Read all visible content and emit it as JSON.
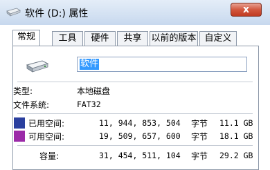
{
  "window": {
    "title": "软件 (D:) 属性",
    "close_symbol": "x"
  },
  "tabs": [
    {
      "label": "常规",
      "active": true
    },
    {
      "label": "工具"
    },
    {
      "label": "硬件"
    },
    {
      "label": "共享"
    },
    {
      "label": "以前的版本"
    },
    {
      "label": "自定义"
    }
  ],
  "general": {
    "volume_name": "软件",
    "type_label": "类型:",
    "type_value": "本地磁盘",
    "fs_label": "文件系统:",
    "fs_value": "FAT32",
    "used": {
      "label": "已用空间:",
      "bytes": "11, 944, 853, 504",
      "unit": "字节",
      "size": "11.1 GB",
      "color": "#2a3f9e"
    },
    "free": {
      "label": "可用空间:",
      "bytes": "19, 509, 657, 600",
      "unit": "字节",
      "size": "18.1 GB",
      "color": "#9b2aa8"
    },
    "capacity": {
      "label": "容量:",
      "bytes": "31, 454, 511, 104",
      "unit": "字节",
      "size": "29.2 GB"
    }
  }
}
